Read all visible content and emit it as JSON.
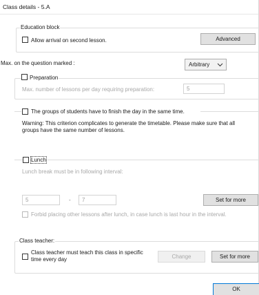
{
  "window": {
    "title": "Class details - 5.A"
  },
  "education_block": {
    "group_label": "Education block",
    "allow_arrival_label": "Allow arrival on second lesson.",
    "advanced_button": "Advanced"
  },
  "max_question": {
    "label": "Max. on the question marked :",
    "selected": "Arbitrary"
  },
  "preparation": {
    "label": "Preparation",
    "max_lessons_label": "Max. number of lessons per day requiring preparation:",
    "max_lessons_value": "5"
  },
  "groups_finish": {
    "label": "The groups of students have to finish the day in the same time.",
    "warning": "Warning: This criterion complicates to generate the timetable. Please make sure that all groups have the same number of lessons."
  },
  "lunch": {
    "label": "Lunch",
    "interval_label": "Lunch break must be in following interval:",
    "from_value": "5",
    "dash": "-",
    "to_value": "7",
    "set_more_button": "Set for more",
    "forbid_label": "Forbid placing other lessons after lunch, in case lunch is last hour in the interval."
  },
  "class_teacher": {
    "group_label": "Class teacher:",
    "must_teach_label": "Class teacher must teach this class in specific time every day",
    "change_button": "Change",
    "set_more_button": "Set for more"
  },
  "footer": {
    "ok_button": "OK"
  }
}
